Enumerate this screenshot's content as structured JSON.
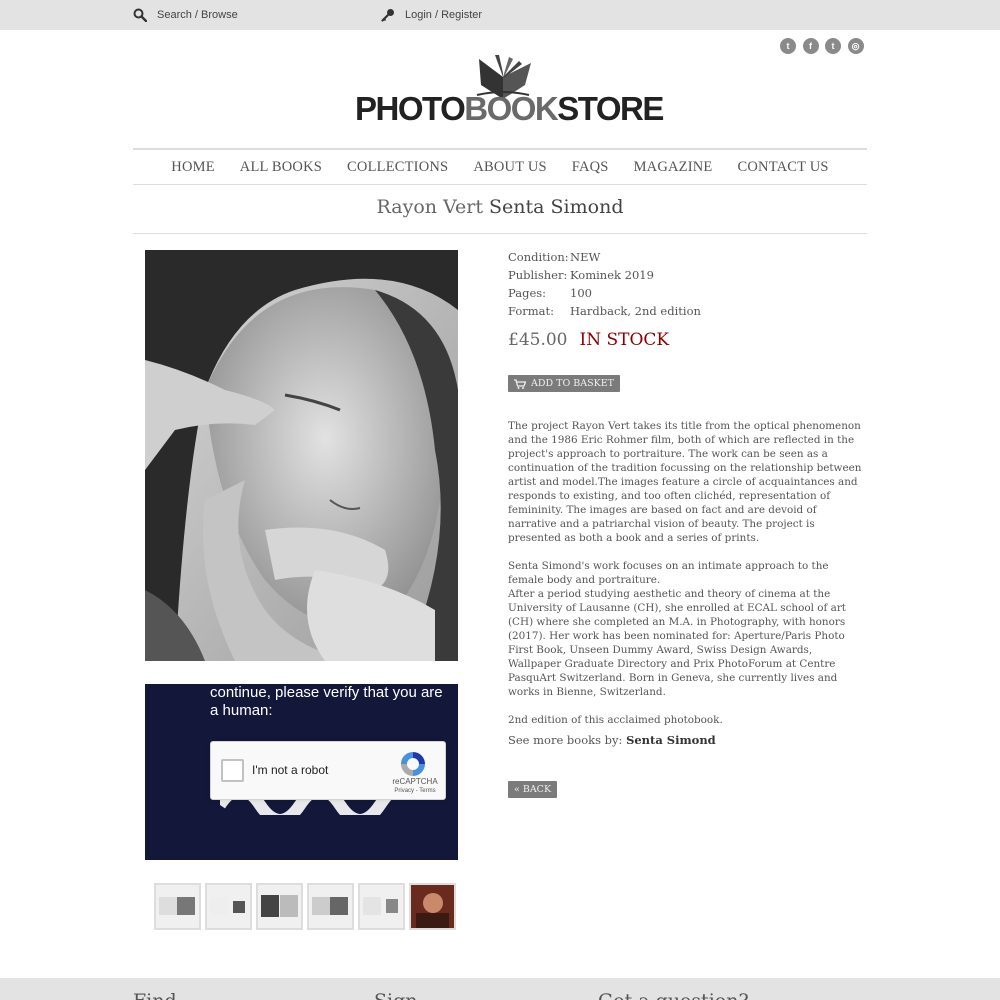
{
  "topbar": {
    "search_label": "Search / Browse",
    "login_label": "Login / Register"
  },
  "social": {
    "icons": [
      "twitter-icon",
      "facebook-icon",
      "tumblr-icon",
      "instagram-icon"
    ],
    "glyphs": [
      "t",
      "f",
      "t",
      "◎"
    ]
  },
  "logo": {
    "part1": "PHOTO",
    "part2": "BOOK",
    "part3": "STORE"
  },
  "nav": {
    "items": [
      "HOME",
      "ALL BOOKS",
      "COLLECTIONS",
      "ABOUT US",
      "FAQS",
      "MAGAZINE",
      "CONTACT US"
    ]
  },
  "book": {
    "title": "Rayon Vert",
    "author": "Senta Simond",
    "details": [
      {
        "key": "Condition:",
        "value": "NEW"
      },
      {
        "key": "Publisher:",
        "value": "Kominek 2019"
      },
      {
        "key": "Pages:",
        "value": "100"
      },
      {
        "key": "Format:",
        "value": "Hardback, 2nd edition"
      }
    ],
    "price": "£45.00",
    "stock": "IN STOCK",
    "description": [
      "The project Rayon Vert  takes its title from the optical phenomenon and the 1986 Eric Rohmer film, both of which are reflected in the project's approach to portraiture. The work can be seen as a continuation of the tradition focussing on the relationship between artist and model.The images feature a circle of acquaintances and responds to existing, and too often clichéd, representation of femininity. The images are based on fact and are devoid of narrative and a patriarchal vision of beauty. The project is presented as both a book and a series of prints.",
      "Senta Simond's work focuses on an intimate approach to the female body and portraiture.",
      "After a period studying aesthetic and theory of cinema at the University of Lausanne (CH), she enrolled at ECAL school of art (CH) where she completed an M.A. in Photography, with honors (2017). Her work has been nominated for: Aperture/Paris Photo First Book, Unseen Dummy Award, Swiss Design Awards, Wallpaper Graduate Directory and Prix PhotoForum at Centre PasquArt Switzerland. Born in Geneva, she currently lives and works in Bienne, Switzerland.",
      "2nd edition of this acclaimed photobook."
    ],
    "see_more_label": "See more books by:",
    "see_more_author": "Senta Simond"
  },
  "buttons": {
    "add_to_basket": "ADD TO BASKET",
    "back": "« BACK"
  },
  "captcha": {
    "prompt": "continue, please verify that you are a human:",
    "checkbox_label": "I'm not a robot",
    "brand": "reCAPTCHA",
    "terms": "Privacy - Terms"
  },
  "footer": {
    "items": [
      "Find",
      "Sign",
      "Got a question?"
    ]
  }
}
